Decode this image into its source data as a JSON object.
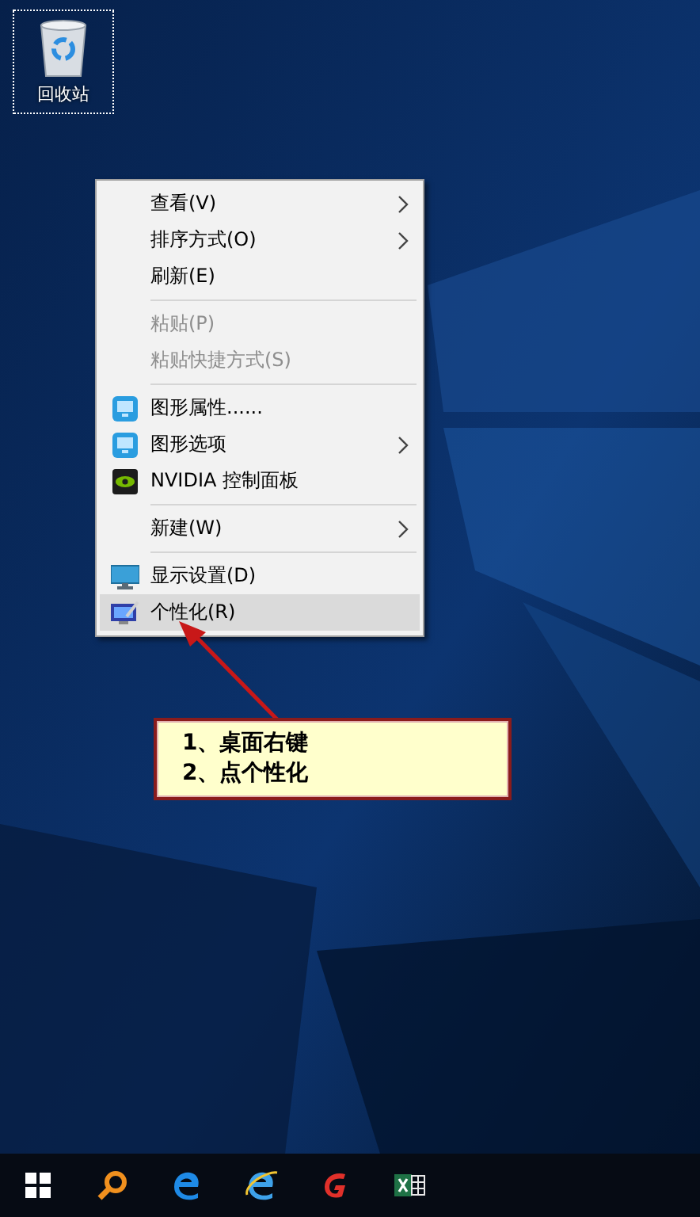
{
  "desktop_icons": [
    {
      "label": "回收站",
      "selected": true
    }
  ],
  "context_menu": {
    "items": [
      {
        "kind": "plain",
        "label": "查看(V)",
        "disabled": false,
        "submenu": true,
        "highlighted": false
      },
      {
        "kind": "plain",
        "label": "排序方式(O)",
        "disabled": false,
        "submenu": true,
        "highlighted": false
      },
      {
        "kind": "plain",
        "label": "刷新(E)",
        "disabled": false,
        "submenu": false,
        "highlighted": false
      },
      {
        "kind": "separator"
      },
      {
        "kind": "plain",
        "label": "粘贴(P)",
        "disabled": true,
        "submenu": false,
        "highlighted": false
      },
      {
        "kind": "plain",
        "label": "粘贴快捷方式(S)",
        "disabled": true,
        "submenu": false,
        "highlighted": false
      },
      {
        "kind": "separator"
      },
      {
        "kind": "graphics",
        "label": "图形属性......",
        "disabled": false,
        "submenu": false,
        "highlighted": false
      },
      {
        "kind": "graphics",
        "label": "图形选项",
        "disabled": false,
        "submenu": true,
        "highlighted": false
      },
      {
        "kind": "nvidia",
        "label": "NVIDIA 控制面板",
        "disabled": false,
        "submenu": false,
        "highlighted": false
      },
      {
        "kind": "separator"
      },
      {
        "kind": "plain",
        "label": "新建(W)",
        "disabled": false,
        "submenu": true,
        "highlighted": false
      },
      {
        "kind": "separator"
      },
      {
        "kind": "display",
        "label": "显示设置(D)",
        "disabled": false,
        "submenu": false,
        "highlighted": false
      },
      {
        "kind": "personalize",
        "label": "个性化(R)",
        "disabled": false,
        "submenu": false,
        "highlighted": true
      }
    ]
  },
  "callout": {
    "lines": [
      "1、桌面右键",
      "2、点个性化"
    ]
  },
  "taskbar": {
    "apps": [
      {
        "kind": "start"
      },
      {
        "kind": "search"
      },
      {
        "kind": "edge"
      },
      {
        "kind": "ie"
      },
      {
        "kind": "red-app"
      },
      {
        "kind": "excel"
      }
    ]
  }
}
